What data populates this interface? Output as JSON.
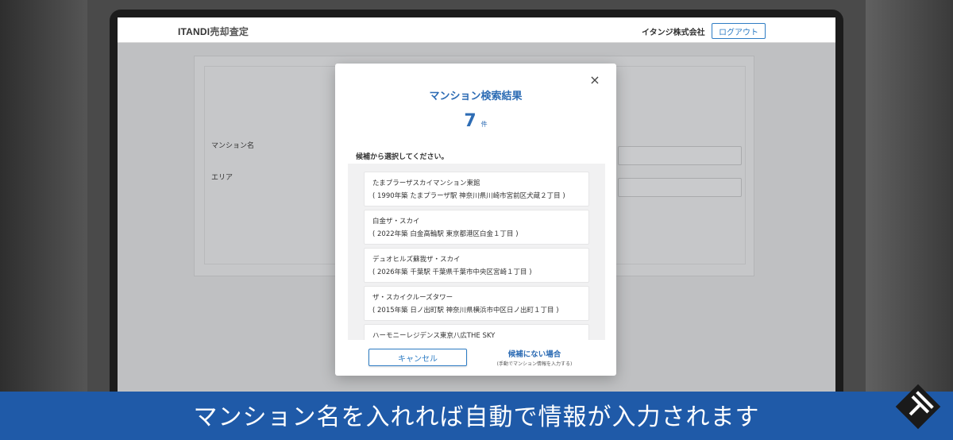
{
  "header": {
    "logo_text": "ITANDI",
    "logo_sub": "売却査定",
    "company_name": "イタンジ株式会社",
    "logout_label": "ログアウト"
  },
  "form": {
    "building_label": "マンション名",
    "area_label": "エリア"
  },
  "modal": {
    "title": "マンション検索結果",
    "count": "7",
    "count_unit": "件",
    "prompt": "候補から選択してください。",
    "results": [
      {
        "name": "たまプラーザスカイマンション東館",
        "detail": "( 1990年築 たまプラーザ駅 神奈川県川崎市宮前区犬蔵２丁目 )"
      },
      {
        "name": "白金ザ・スカイ",
        "detail": "( 2022年築 白金高輪駅 東京都港区白金１丁目 )"
      },
      {
        "name": "デュオヒルズ蘇我ザ・スカイ",
        "detail": "( 2026年築 千葉駅 千葉県千葉市中央区宮崎１丁目 )"
      },
      {
        "name": "ザ・スカイクルーズタワー",
        "detail": "( 2015年築 日ノ出町駅 神奈川県横浜市中区日ノ出町１丁目 )"
      },
      {
        "name": "ハーモニーレジデンス東京八広THE SKY",
        "detail": ""
      }
    ],
    "cancel_label": "キャンセル",
    "manual_link": "候補にない場合",
    "manual_note": "(手動でマンション情報を入力する)"
  },
  "subtitle": "マンション名を入れれば自動で情報が入力されます",
  "colors": {
    "accent": "#2d6cb4",
    "subtitle_bg": "#1f5aa8"
  }
}
